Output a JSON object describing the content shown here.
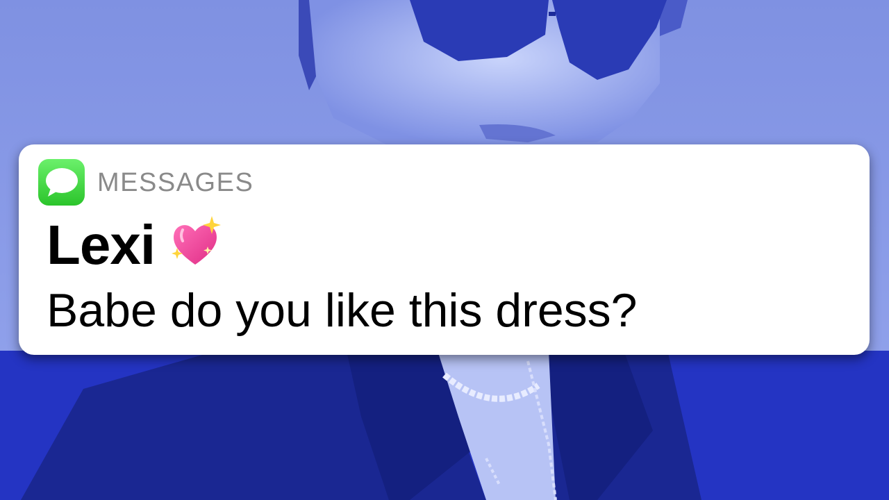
{
  "notification": {
    "app_name": "MESSAGES",
    "app_icon": "messages-bubble-icon",
    "sender": "Lexi",
    "sender_emoji": "sparkling-heart-icon",
    "message": "Babe do you like this dress?"
  },
  "colors": {
    "background_light": "#8a9ae8",
    "background_dark": "#1f30bf",
    "card": "#ffffff",
    "app_icon_green": "#34c934",
    "app_name_gray": "#8a8a8a",
    "heart_pink": "#f0449a"
  }
}
